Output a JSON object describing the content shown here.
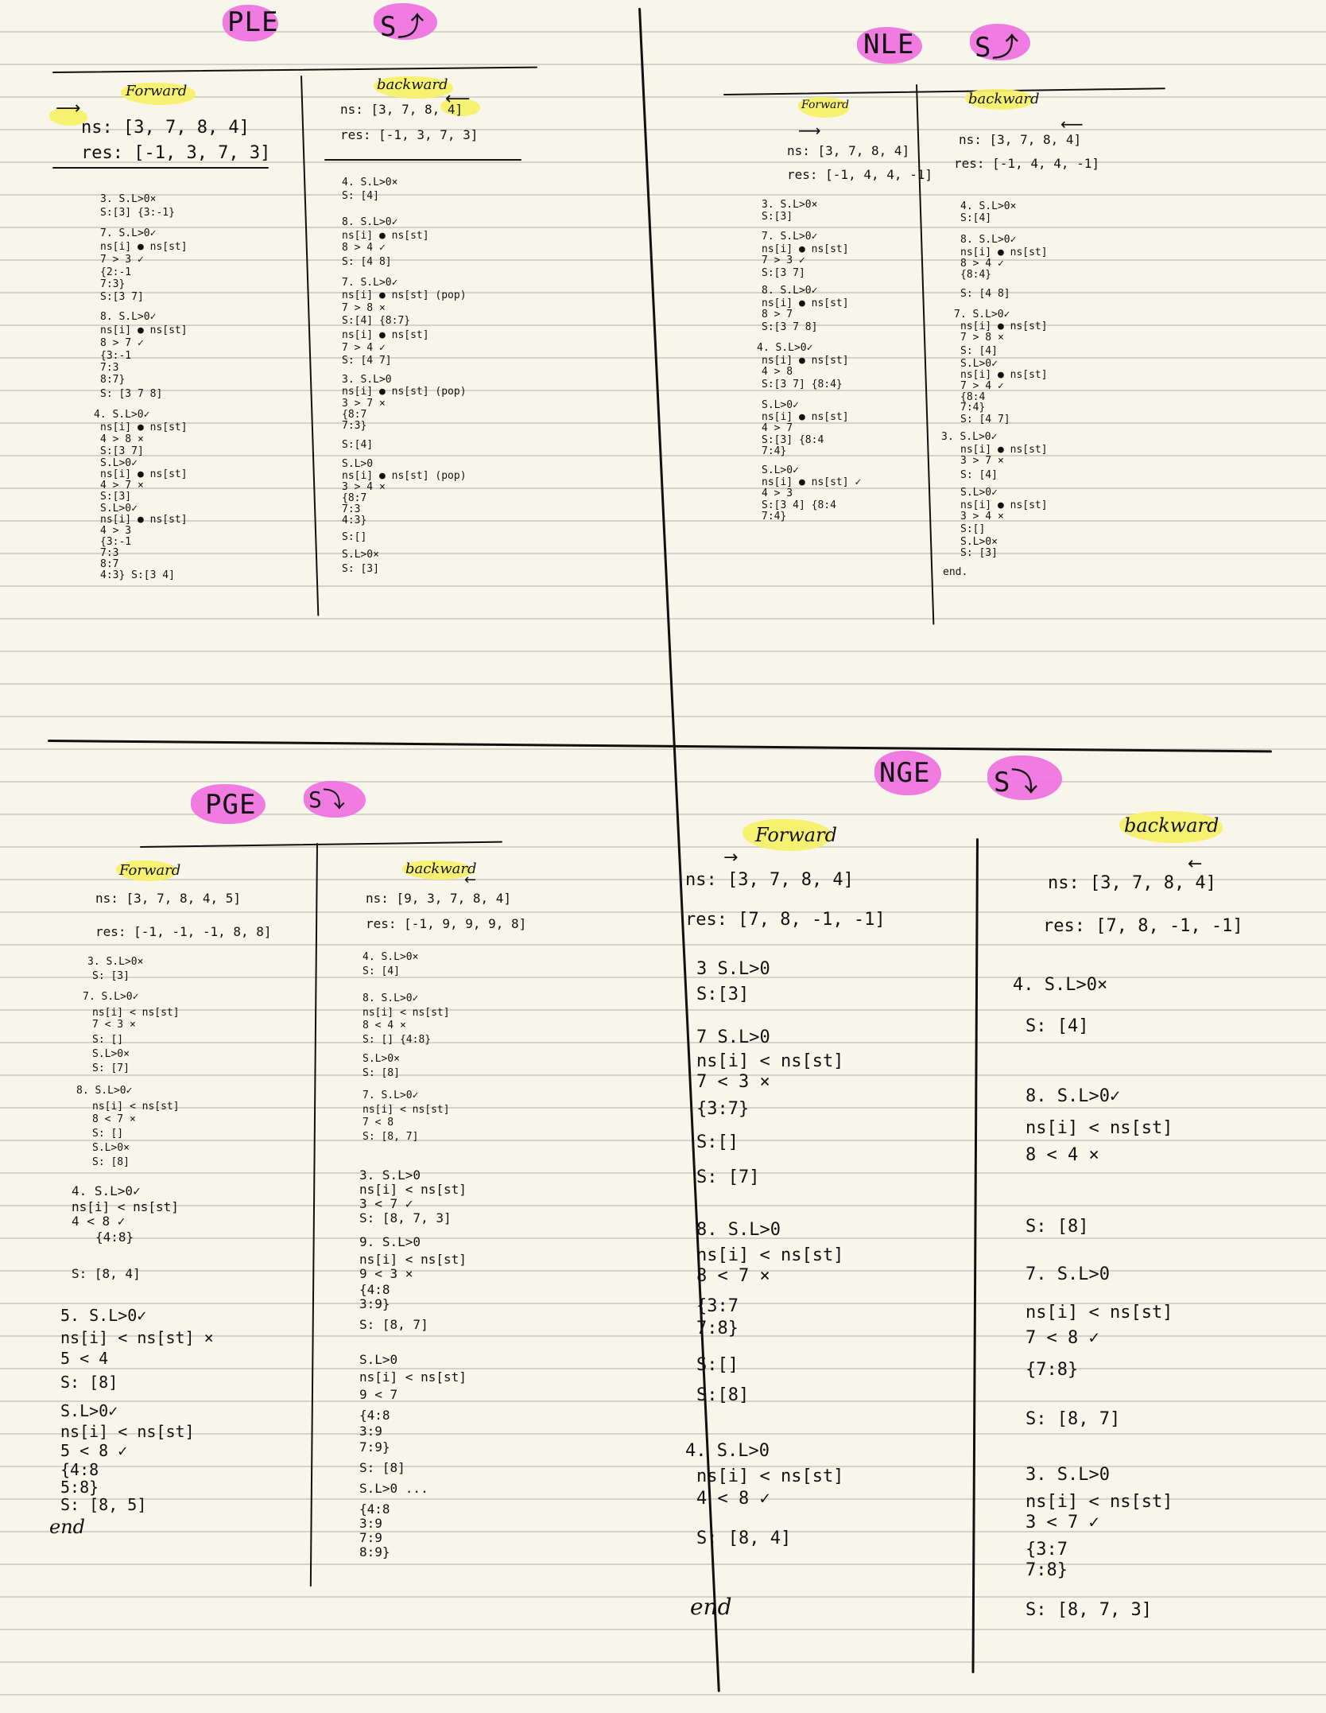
{
  "quadrants": {
    "ple": {
      "title": "PLE",
      "stack_label": "S⤴",
      "forward": {
        "label": "Forward",
        "arrow": "⟶",
        "lines": [
          "ns: [3, 7, 8, 4]",
          "res: [-1, 3, 7, 3]",
          "3. S.L>0×",
          "   S:[3]     {3:-1}",
          "7. S.L>0✓",
          "   ns[i] ● ns[st]",
          "     7  > 3 ✓",
          "   {2:-1",
          "    7:3}",
          "   S:[3 7]",
          "8. S.L>0✓",
          "   ns[i] ● ns[st]",
          "     8  > 7 ✓",
          "   {3:-1",
          "    7:3",
          "    8:7}",
          "   S: [3 7 8]",
          "4. S.L>0✓",
          "   ns[i] ● ns[st]",
          "     4  > 8 ×",
          "   S:[3 7]",
          "   S.L>0✓",
          "   ns[i] ● ns[st]",
          "     4  > 7 ×",
          "   S:[3]",
          "   S.L>0✓",
          "   ns[i] ● ns[st]",
          "     4  > 3",
          "   {3:-1",
          "    7:3",
          "    8:7",
          "    4:3}   S:[3 4]"
        ]
      },
      "backward": {
        "label": "backward",
        "arrow": "⟵",
        "lines": [
          "ns: [3, 7, 8, 4]",
          "res: [-1, 3, 7, 3]",
          "4. S.L>0×",
          "   S: [4]",
          "8. S.L>0✓",
          "   ns[i] ● ns[st]",
          "     8  > 4 ✓",
          "   S: [4 8]",
          "7. S.L>0✓",
          "   ns[i] ● ns[st]  (pop)",
          "     7  > 8 ×",
          "   S:[4]       {8:7}",
          "   ns[i] ● ns[st]",
          "     7  > 4 ✓",
          "   S: [4 7]",
          "3. S.L>0",
          "   ns[i] ● ns[st]  (pop)",
          "     3  > 7 ×",
          "               {8:7",
          "                7:3}",
          "   S:[4]",
          "   S.L>0",
          "   ns[i] ● ns[st]  (pop)",
          "     3  > 4 ×",
          "               {8:7",
          "                7:3",
          "                4:3}",
          "   S:[]",
          "   S.L>0×",
          "   S: [3]"
        ]
      }
    },
    "nle": {
      "title": "NLE",
      "stack_label": "S⤴",
      "forward": {
        "label": "Forward",
        "arrow": "⟶",
        "lines": [
          "ns: [3, 7, 8, 4]",
          "res: [-1, 4, 4, -1]",
          "3. S.L>0×",
          "   S:[3]",
          "7. S.L>0✓",
          "   ns[i] ● ns[st]",
          "     7  > 3 ✓",
          "   S:[3 7]",
          "8. S.L>0✓",
          "   ns[i] ● ns[st]",
          "     8  > 7",
          "   S:[3 7 8]",
          "4. S.L>0✓",
          "   ns[i] ● ns[st]",
          "     4  > 8",
          "   S:[3 7]      {8:4}",
          "   S.L>0✓",
          "   ns[i] ● ns[st]",
          "     4  > 7",
          "   S:[3]       {8:4",
          "                7:4}",
          "   S.L>0✓",
          "   ns[i] ● ns[st] ✓",
          "     4  > 3",
          "   S:[3 4]     {8:4",
          "                7:4}"
        ]
      },
      "backward": {
        "label": "backward",
        "arrow": "⟵",
        "lines": [
          "ns: [3, 7, 8, 4]",
          "res: [-1, 4, 4, -1]",
          "4. S.L>0×",
          "   S:[4]",
          "8. S.L>0✓",
          "   ns[i] ● ns[st]",
          "     8  > 4 ✓",
          "   {8:4}",
          "   S: [4 8]",
          "7. S.L>0✓",
          "   ns[i] ● ns[st]",
          "     7  > 8 ×",
          "   S: [4]",
          "   S.L>0✓",
          "   ns[i] ● ns[st]",
          "     7  > 4 ✓",
          "   {8:4",
          "    7:4}",
          "   S: [4 7]",
          "3. S.L>0✓",
          "   ns[i] ● ns[st]",
          "     3  > 7 ×",
          "   S: [4]",
          "   S.L>0✓",
          "   ns[i] ● ns[st]",
          "     3  > 4 ×",
          "   S:[]",
          "   S.L>0×",
          "   S: [3]",
          "end."
        ]
      }
    },
    "pge": {
      "title": "PGE",
      "stack_label": "S⤵",
      "forward": {
        "label": "Forward",
        "arrow": "",
        "lines": [
          "ns: [3, 7, 8, 4, 5]",
          "res: [-1, -1, -1, 8, 8]",
          "3. S.L>0×",
          "   S: [3]",
          "7. S.L>0✓",
          "   ns[i] < ns[st]",
          "     7  < 3 ×",
          "   S: []",
          "   S.L>0×",
          "   S: [7]",
          "8. S.L>0✓",
          "   ns[i] < ns[st]",
          "     8  < 7 ×",
          "   S: []",
          "   S.L>0×",
          "   S: [8]",
          "4. S.L>0✓",
          "   ns[i] < ns[st]",
          "     4  < 8 ✓",
          "   {4:8}",
          "   S: [8, 4]",
          "5. S.L>0✓",
          "   ns[i] < ns[st] ×",
          "     5  < 4",
          "   S: [8]",
          "   S.L>0✓",
          "   ns[i] < ns[st]",
          "     5  < 8 ✓",
          "   {4:8",
          "    5:8}",
          "   S: [8, 5]",
          "end"
        ]
      },
      "backward": {
        "label": "backward",
        "arrow": "←",
        "lines": [
          "ns: [9, 3, 7, 8, 4]",
          "res: [-1, 9, 9, 9, 8]",
          "4. S.L>0×",
          "   S: [4]",
          "8. S.L>0✓",
          "   ns[i] < ns[st]",
          "     8  < 4 ×",
          "   S: []        {4:8}",
          "   S.L>0×",
          "   S: [8]",
          "7. S.L>0✓",
          "   ns[i] < ns[st]",
          "     7  < 8",
          "   S: [8, 7]",
          "3. S.L>0",
          "   ns[i] < ns[st]",
          "     3  < 7 ✓",
          "   S: [8, 7, 3]",
          "9. S.L>0",
          "   ns[i] < ns[st]",
          "     9  < 3 ×",
          "   {4:8",
          "    3:9}",
          "   S: [8, 7]",
          "   S.L>0",
          "   ns[i] < ns[st]",
          "     9  < 7",
          "   {4:8",
          "    3:9",
          "    7:9}",
          "   S: [8]",
          "   S.L>0 ...",
          "   {4:8",
          "    3:9",
          "    7:9",
          "    8:9}"
        ]
      }
    },
    "nge": {
      "title": "NGE",
      "stack_label": "S⤵",
      "forward": {
        "label": "Forward",
        "arrow": "→",
        "lines": [
          "ns: [3, 7, 8, 4]",
          "res: [7, 8, -1, -1]",
          "3  S.L>0",
          "   S:[3]",
          "7  S.L>0",
          "   ns[i] < ns[st]",
          "     7  <  3 ×",
          "       {3:7}",
          "   S:[]",
          "   S: [7]",
          "8. S.L>0",
          "   ns[i] < ns[st]",
          "     8  <  7 ×",
          "       {3:7",
          "        7:8}",
          "   S:[]",
          "   S:[8]",
          "4. S.L>0",
          "   ns[i] < ns[st]",
          "     4  <  8 ✓",
          "   S: [8, 4]",
          "end"
        ]
      },
      "backward": {
        "label": "backward",
        "arrow": "←",
        "lines": [
          "ns: [3, 7, 8, 4]",
          "res: [7, 8, -1, -1]",
          "4. S.L>0×",
          "   S: [4]",
          "8. S.L>0✓",
          "   ns[i] < ns[st]",
          "     8  <  4 ×",
          "   S: [8]",
          "7. S.L>0",
          "   ns[i] < ns[st]",
          "     7  <  8 ✓",
          "       {7:8}",
          "   S: [8, 7]",
          "3. S.L>0",
          "   ns[i] < ns[st]",
          "     3  <  7 ✓",
          "       {3:7",
          "        7:8}",
          "   S: [8, 7, 3]"
        ]
      }
    }
  },
  "colors": {
    "paper": "#f8f6ea",
    "rule_line": "#d3d3cc",
    "ink": "#111111",
    "pink_highlight": "#ee6fe0",
    "yellow_highlight": "#f7f06b"
  }
}
